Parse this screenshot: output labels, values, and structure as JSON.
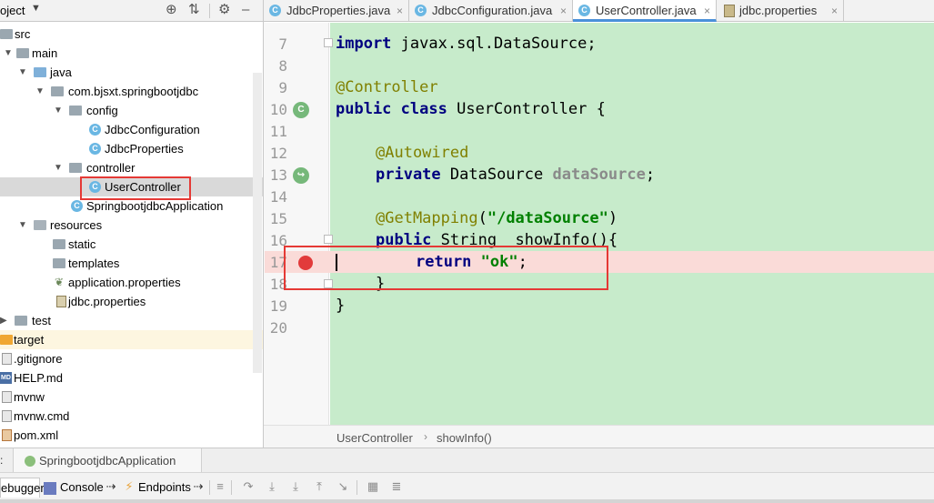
{
  "project_panel": {
    "title": "oject",
    "tree": [
      {
        "label": "src",
        "kind": "folder"
      },
      {
        "label": "main",
        "kind": "folder"
      },
      {
        "label": "java",
        "kind": "folder-blue"
      },
      {
        "label": "com.bjsxt.springbootjdbc",
        "kind": "package"
      },
      {
        "label": "config",
        "kind": "package"
      },
      {
        "label": "JdbcConfiguration",
        "kind": "class"
      },
      {
        "label": "JdbcProperties",
        "kind": "class"
      },
      {
        "label": "controller",
        "kind": "package"
      },
      {
        "label": "UserController",
        "kind": "class"
      },
      {
        "label": "SpringbootjdbcApplication",
        "kind": "class"
      },
      {
        "label": "resources",
        "kind": "folder-res"
      },
      {
        "label": "static",
        "kind": "folder"
      },
      {
        "label": "templates",
        "kind": "folder"
      },
      {
        "label": "application.properties",
        "kind": "spring"
      },
      {
        "label": "jdbc.properties",
        "kind": "properties"
      },
      {
        "label": "test",
        "kind": "folder"
      },
      {
        "label": "target",
        "kind": "folder-orange"
      },
      {
        "label": ".gitignore",
        "kind": "file"
      },
      {
        "label": "HELP.md",
        "kind": "md"
      },
      {
        "label": "mvnw",
        "kind": "file"
      },
      {
        "label": "mvnw.cmd",
        "kind": "file"
      },
      {
        "label": "pom.xml",
        "kind": "maven"
      }
    ]
  },
  "editor_tabs": [
    {
      "label": "JdbcProperties.java"
    },
    {
      "label": "JdbcConfiguration.java"
    },
    {
      "label": "UserController.java"
    },
    {
      "label": "jdbc.properties"
    }
  ],
  "code_lines": [
    {
      "no": "7",
      "text": "import javax.sql.DataSource;"
    },
    {
      "no": "8",
      "text": ""
    },
    {
      "no": "9",
      "text": "@Controller"
    },
    {
      "no": "10",
      "text": "public class UserController {"
    },
    {
      "no": "11",
      "text": ""
    },
    {
      "no": "12",
      "text": "@Autowired"
    },
    {
      "no": "13",
      "text": "private DataSource dataSource;"
    },
    {
      "no": "14",
      "text": ""
    },
    {
      "no": "15",
      "text": "@GetMapping(\"/dataSource\")"
    },
    {
      "no": "16",
      "text": "public String  showInfo(){"
    },
    {
      "no": "17",
      "text": "return \"ok\";"
    },
    {
      "no": "18",
      "text": "}"
    },
    {
      "no": "19",
      "text": "}"
    },
    {
      "no": "20",
      "text": ""
    }
  ],
  "code_tokens": {
    "import": "import",
    "import_rest": " javax.sql.DataSource;",
    "controller_ann": "@Controller",
    "public": "public",
    "class": "class",
    "class_rest": " UserController {",
    "autowired_ann": "@Autowired",
    "private": "private",
    "datasource_type": " DataSource ",
    "datasource_field": "dataSource",
    "semicolon": ";",
    "getmapping_ann": "@GetMapping",
    "paren_open": "(",
    "mapping_str": "\"/dataSource\"",
    "paren_close": ")",
    "public2": "public",
    "method_rest": " String  showInfo(){",
    "return": "return",
    "ok_str": "\"ok\"",
    "return_end": ";",
    "close_brace": "}",
    "close_brace2": "}"
  },
  "breadcrumb": [
    "UserController",
    "showInfo()"
  ],
  "run_panel": {
    "prefix": ":",
    "config": "SpringbootjdbcApplication"
  },
  "debug_tabs": [
    "ebugger",
    "Console",
    "Endpoints"
  ],
  "colors": {
    "code_bg": "#c7ebcb",
    "breakpoint": "#e23b3b",
    "breakpoint_line": "#fadbd8",
    "highlight_box": "#e53935"
  }
}
